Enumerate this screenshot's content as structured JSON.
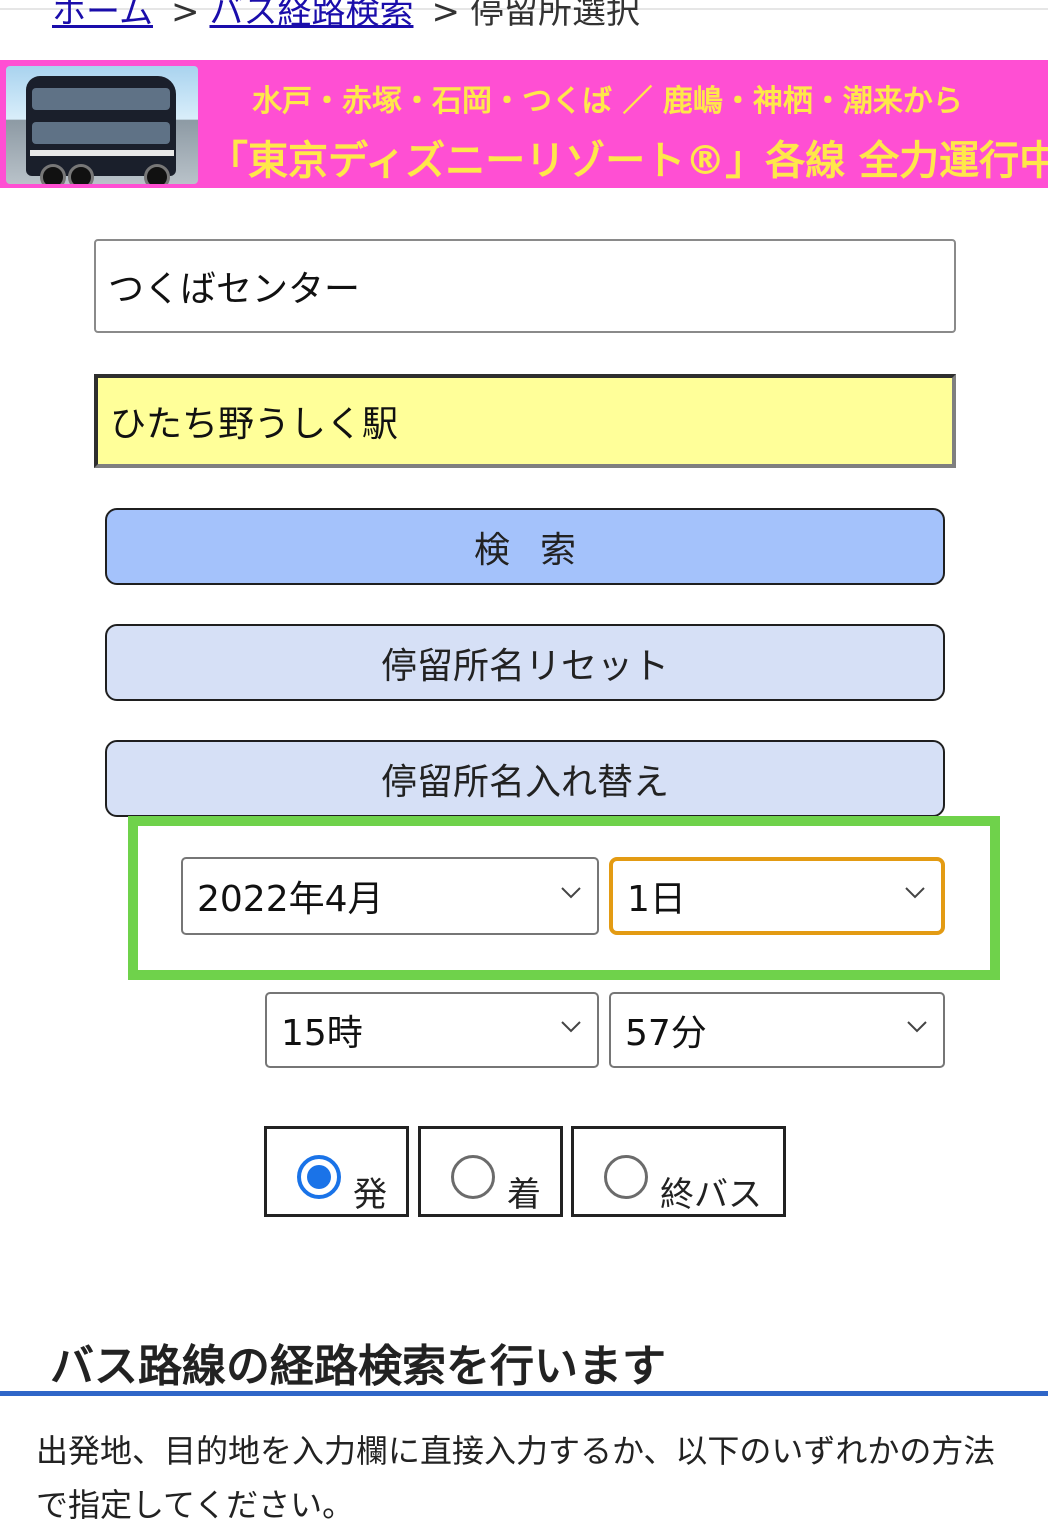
{
  "breadcrumb": {
    "items": [
      "ホーム",
      "バス経路検索"
    ],
    "current": "停留所選択",
    "separator": ">"
  },
  "banner": {
    "line1": "水戸・赤塚・石岡・つくば ／ 鹿嶋・神栖・潮来から",
    "line2": "「東京ディズニーリゾート®」各線 全力運行中！",
    "background_color": "#ff4fd3",
    "text_color": "#ffe74a"
  },
  "form": {
    "from_value": "つくばセンター",
    "to_value": "ひたち野うしく駅",
    "search_label": "検索",
    "reset_label": "停留所名リセット",
    "swap_label": "停留所名入れ替え"
  },
  "datetime": {
    "month": "2022年4月",
    "day": "1日",
    "hour": "15時",
    "minute": "57分"
  },
  "mode": {
    "options": [
      "発",
      "着",
      "終バス"
    ],
    "selected": "発",
    "accent_color": "#1a73e8"
  },
  "section": {
    "heading": "バス路線の経路検索を行います",
    "body": "出発地、目的地を入力欄に直接入力するか、以下のいずれかの方法で指定してください。"
  },
  "colors": {
    "highlight_frame": "#6fd24b",
    "focused_select": "#e39b13",
    "search_button": "#a4c2fb",
    "secondary_button": "#d6e0f6",
    "destination_field": "#ffff99"
  }
}
